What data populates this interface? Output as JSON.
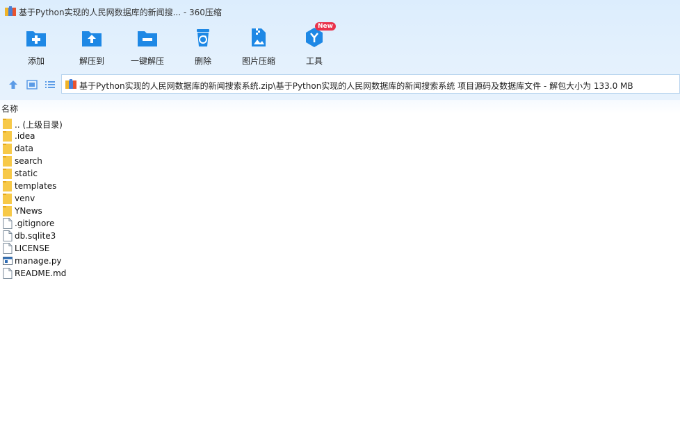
{
  "window": {
    "title": "基于Python实现的人民网数据库的新闻搜... - 360压缩"
  },
  "toolbar": {
    "items": [
      {
        "label": "添加",
        "icon": "add-folder-icon"
      },
      {
        "label": "解压到",
        "icon": "extract-to-icon"
      },
      {
        "label": "一键解压",
        "icon": "one-click-extract-icon"
      },
      {
        "label": "删除",
        "icon": "recycle-bin-icon"
      },
      {
        "label": "图片压缩",
        "icon": "image-compress-icon"
      },
      {
        "label": "工具",
        "icon": "tools-icon"
      }
    ],
    "new_badge": "New"
  },
  "address": {
    "path": "基于Python实现的人民网数据库的新闻搜索系统.zip\\基于Python实现的人民网数据库的新闻搜索系统 项目源码及数据库文件 - 解包大小为 133.0 MB"
  },
  "list": {
    "column_name": "名称",
    "items": [
      {
        "name": ".. (上级目录)",
        "type": "folder"
      },
      {
        "name": ".idea",
        "type": "folder"
      },
      {
        "name": "data",
        "type": "folder"
      },
      {
        "name": "search",
        "type": "folder"
      },
      {
        "name": "static",
        "type": "folder"
      },
      {
        "name": "templates",
        "type": "folder"
      },
      {
        "name": "venv",
        "type": "folder"
      },
      {
        "name": "YNews",
        "type": "folder"
      },
      {
        "name": ".gitignore",
        "type": "file"
      },
      {
        "name": "db.sqlite3",
        "type": "file"
      },
      {
        "name": "LICENSE",
        "type": "file"
      },
      {
        "name": "manage.py",
        "type": "python"
      },
      {
        "name": "README.md",
        "type": "file"
      }
    ]
  },
  "colors": {
    "accent": "#1e88e5",
    "chrome_bg": "#dcedfd",
    "folder": "#f7c948",
    "badge": "#e9324b"
  }
}
